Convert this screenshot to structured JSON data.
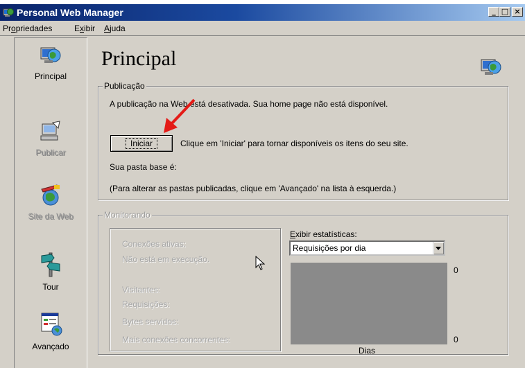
{
  "window": {
    "title": "Personal Web Manager",
    "controls": [
      "minimize",
      "maximize",
      "close"
    ]
  },
  "menubar": {
    "items": [
      {
        "label_pre": "Pr",
        "label_accel": "o",
        "label_post": "priedades"
      },
      {
        "label_pre": "E",
        "label_accel": "x",
        "label_post": "ibir"
      },
      {
        "label_pre": "",
        "label_accel": "A",
        "label_post": "juda"
      }
    ]
  },
  "sidebar": {
    "items": [
      {
        "label": "Principal",
        "icon": "globe-monitor-icon",
        "enabled": true
      },
      {
        "label": "Publicar",
        "icon": "publish-computer-icon",
        "enabled": false
      },
      {
        "label": "Site da Web",
        "icon": "web-site-icon",
        "enabled": false
      },
      {
        "label": "Tour",
        "icon": "tour-signpost-icon",
        "enabled": true
      },
      {
        "label": "Avançado",
        "icon": "advanced-window-icon",
        "enabled": true
      }
    ]
  },
  "main": {
    "title": "Principal",
    "publicacao": {
      "legend": "Publicação",
      "status_text": "A publicação na Web está desativada. Sua home page não está disponível.",
      "start_button": "Iniciar",
      "start_hint": "Clique em 'Iniciar' para tornar disponíveis os itens do seu site.",
      "home_folder_label": "Sua pasta base é:",
      "advanced_hint": "(Para alterar as pastas publicadas, clique em 'Avançado' na lista à esquerda.)"
    },
    "monitorando": {
      "legend": "Monitorando",
      "active_connections": "Conexões ativas:",
      "not_running": "Não está em execução.",
      "visitors": "Visitantes:",
      "requests": "Requisições:",
      "bytes_served": "Bytes servidos:",
      "max_connections": "Mais conexões concorrentes:",
      "stats_label": "Exibir estatísticas:",
      "stats_selected": "Requisições por dia",
      "chart_top_value": "0",
      "chart_bottom_value": "0",
      "chart_x_label": "Dias"
    }
  },
  "colors": {
    "titlebar_start": "#0a246a",
    "titlebar_end": "#a6caf0",
    "face": "#d4d0c8",
    "chart_bg": "#8a8a8a",
    "annotation_arrow": "#e41b17"
  }
}
